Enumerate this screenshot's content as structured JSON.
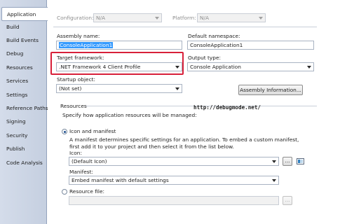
{
  "tabs": [
    "Application",
    "Build",
    "Build Events",
    "Debug",
    "Resources",
    "Services",
    "Settings",
    "Reference Paths",
    "Signing",
    "Security",
    "Publish",
    "Code Analysis"
  ],
  "top": {
    "configuration_label": "Configuration:",
    "configuration_value": "N/A",
    "platform_label": "Platform:",
    "platform_value": "N/A"
  },
  "assembly_name": {
    "label": "Assembly name:",
    "value": "ConsoleApplication1"
  },
  "default_namespace": {
    "label": "Default namespace:",
    "value": "ConsoleApplication1"
  },
  "target_framework": {
    "label": "Target framework:",
    "value": ".NET Framework 4 Client Profile"
  },
  "output_type": {
    "label": "Output type:",
    "value": "Console Application"
  },
  "startup_object": {
    "label": "Startup object:",
    "value": "(Not set)"
  },
  "assembly_info_button": "Assembly Information...",
  "resources": {
    "title": "Resources",
    "description": "Specify how application resources will be managed:",
    "watermark": "http://debugmode.net/",
    "icon_manifest": {
      "label": "Icon and manifest",
      "selected": true,
      "help": "A manifest determines specific settings for an application. To embed a custom manifest, first add it to your project and then select it from the list below.",
      "icon_label": "Icon:",
      "icon_value": "(Default Icon)",
      "browse": "...",
      "manifest_label": "Manifest:",
      "manifest_value": "Embed manifest with default settings"
    },
    "resource_file": {
      "label": "Resource file:",
      "selected": false,
      "value": "",
      "browse": "..."
    }
  },
  "colors": {
    "highlight": "#d8203a",
    "selection": "#3399ff"
  }
}
